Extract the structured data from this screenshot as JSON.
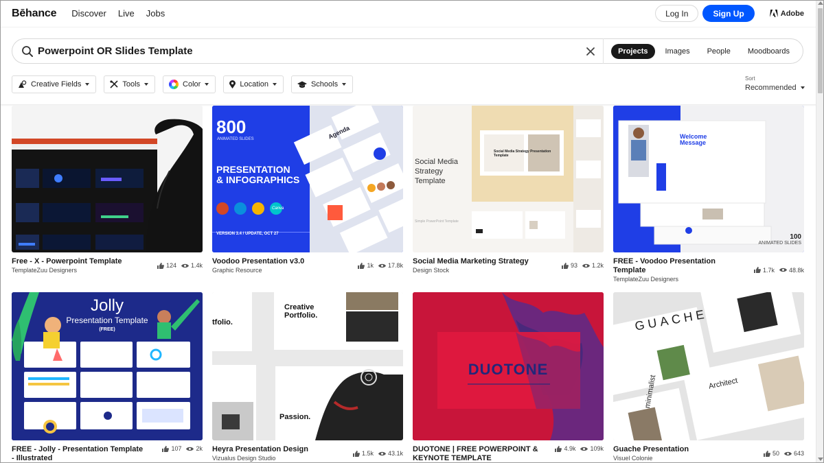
{
  "header": {
    "logo": "Bēhance",
    "nav": [
      "Discover",
      "Live",
      "Jobs"
    ],
    "login": "Log In",
    "signup": "Sign Up",
    "adobe": "Adobe"
  },
  "search": {
    "query": "Powerpoint OR Slides Template",
    "tabs": [
      "Projects",
      "Images",
      "People",
      "Moodboards"
    ],
    "active_tab": "Projects"
  },
  "filters": [
    "Creative Fields",
    "Tools",
    "Color",
    "Location",
    "Schools"
  ],
  "sort": {
    "label": "Sort",
    "value": "Recommended"
  },
  "projects": [
    {
      "title": "Free - X - Powerpoint Template",
      "owner": "TemplateZuu Designers",
      "likes": "124",
      "views": "1.4k"
    },
    {
      "title": "Voodoo Presentation v3.0",
      "owner": "Graphic Resource",
      "likes": "1k",
      "views": "17.8k",
      "thumb": {
        "big": "800",
        "sub": "ANIMATED SLIDES",
        "h1": "PRESENTATION",
        "h2": "& INFOGRAPHICS",
        "ver": "VERSION 3.4 / UPDATE, OCT 27",
        "agenda": "Agenda",
        "app": "Canva"
      }
    },
    {
      "title": "Social Media Marketing Strategy",
      "owner": "Design Stock",
      "likes": "93",
      "views": "1.2k",
      "thumb": {
        "heading": [
          "Social Media",
          "Strategy",
          "Template"
        ],
        "card": "Social Media Strategy Presentation Template",
        "foot": "Simple PowerPoint Template"
      }
    },
    {
      "title": "FREE - Voodoo Presentation Template",
      "owner": "TemplateZuu Designers",
      "likes": "1.7k",
      "views": "48.8k",
      "thumb": {
        "welcome": "Welcome",
        "message": "Message",
        "count": "100",
        "count_sub": "ANIMATED SLIDES"
      }
    },
    {
      "title": "FREE - Jolly - Presentation Template - Illustrated",
      "owner": "",
      "likes": "107",
      "views": "2k",
      "thumb": {
        "t1": "Jolly",
        "t2": "Presentation Template",
        "t3": "(FREE)"
      }
    },
    {
      "title": "Heyra Presentation Design",
      "owner": "Vizualus Design Studio",
      "likes": "1.5k",
      "views": "43.1k",
      "thumb": {
        "a": "Creative",
        "b": "Portfolio.",
        "c": "tfolio.",
        "d": "Passion."
      }
    },
    {
      "title": "DUOTONE | FREE POWERPOINT & KEYNOTE TEMPLATE",
      "owner": "",
      "likes": "4.9k",
      "views": "109k",
      "thumb": {
        "word": "DUOTONE"
      }
    },
    {
      "title": "Guache Presentation",
      "owner": "Visuel Colonie",
      "likes": "50",
      "views": "643",
      "thumb": {
        "word": "GUACHE",
        "side": "minimalist",
        "arch": "Architect"
      }
    }
  ],
  "colors": {
    "brand_blue": "#0057ff",
    "jolly_navy": "#1d2a8a",
    "voodoo_blue": "#1f3ee6",
    "duotone_red": "#d7193c"
  }
}
